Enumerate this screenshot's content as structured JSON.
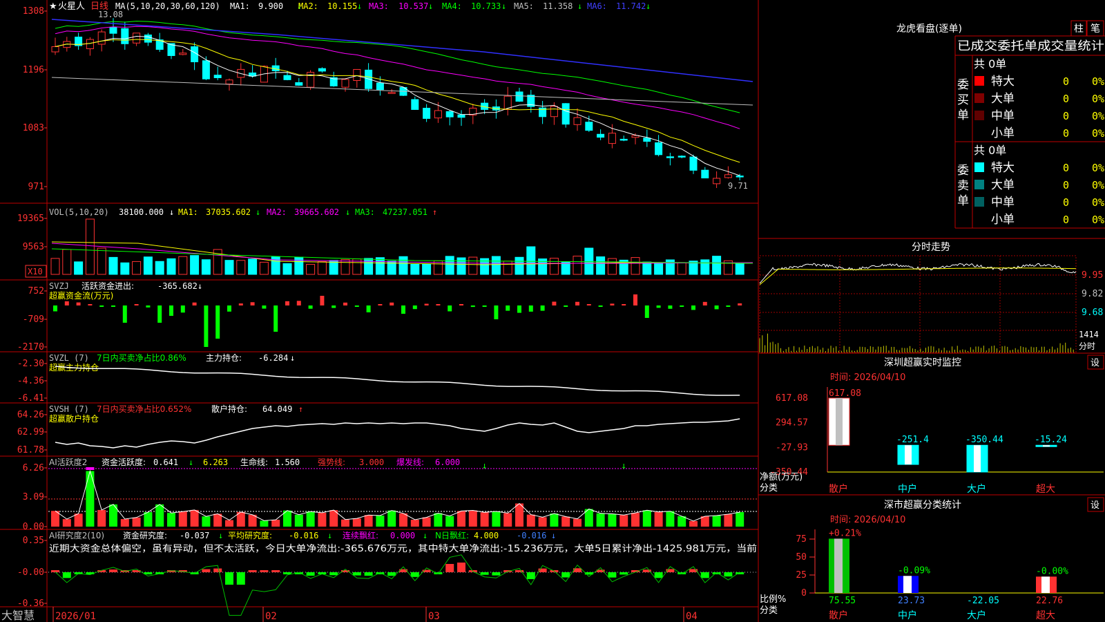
{
  "stock": {
    "name": "火星人",
    "period": "日线",
    "star": "★"
  },
  "price_panel": {
    "ma_label": "MA(5,10,20,30,60,120)",
    "mas": [
      {
        "name": "MA1:",
        "value": "9.900",
        "arrow": "↓",
        "color": "#ffffff"
      },
      {
        "name": "MA2:",
        "value": "10.155",
        "arrow": "↓",
        "color": "#ffff00"
      },
      {
        "name": "MA3:",
        "value": "10.537",
        "arrow": "↓",
        "color": "#ff00ff"
      },
      {
        "name": "MA4:",
        "value": "10.733",
        "arrow": "↓",
        "color": "#00ff00"
      },
      {
        "name": "MA5:",
        "value": "11.358",
        "arrow": "↓",
        "color": "#c0c0c0"
      },
      {
        "name": "MA6:",
        "value": "11.742",
        "arrow": "↓",
        "color": "#4040ff"
      }
    ],
    "y_ticks": [
      "1308",
      "1196",
      "1083",
      "971"
    ],
    "high_label": "13.08",
    "low_label": "9.71"
  },
  "vol_panel": {
    "label": "VOL(5,10,20)",
    "value": "38100.000",
    "arrow": "↓",
    "mas": [
      {
        "name": "MA1:",
        "value": "37035.602",
        "arrow": "↓",
        "color": "#ffff00"
      },
      {
        "name": "MA2:",
        "value": "39665.602",
        "arrow": "↓",
        "color": "#ff00ff"
      },
      {
        "name": "MA3:",
        "value": "47237.051",
        "arrow": "↑",
        "color": "#00ff00"
      }
    ],
    "y_ticks": [
      "19365",
      "9563"
    ],
    "unit": "X10"
  },
  "svzj_panel": {
    "label": "SVZJ",
    "title": "活跃资金进出:",
    "value": "-365.682",
    "arrow": "↓",
    "sub": "超赢资金流(万元)",
    "y_ticks": [
      "752",
      "-709",
      "-2170"
    ]
  },
  "svzl_panel": {
    "label": "SVZL (7)",
    "text1": "7日内买卖净占比0.86%",
    "text2": "主力持仓:",
    "value": "-6.284",
    "arrow": "↓",
    "sub": "超赢主力持仓",
    "y_ticks": [
      "-2.30",
      "-4.36",
      "-6.41"
    ]
  },
  "svsh_panel": {
    "label": "SVSH (7)",
    "text1": "7日内买卖净占比0.652%",
    "text2": "散户持仓:",
    "value": "64.049",
    "arrow": "↑",
    "sub": "超赢散户持仓",
    "y_ticks": [
      "64.26",
      "62.99",
      "61.78"
    ]
  },
  "ai_active_panel": {
    "label": "AI活跃度2",
    "text1": "资金活跃度:",
    "v1": "0.641",
    "a1": "↓",
    "v2": "6.263",
    "text2": "生命线:",
    "v3": "1.560",
    "text3": "强势线:",
    "v4": "3.000",
    "text4": "爆发线:",
    "v5": "6.000",
    "y_ticks": [
      "6.26",
      "3.09",
      "0.00"
    ]
  },
  "ai_research_panel": {
    "label": "AI研究度2(10)",
    "text1": "资金研究度:",
    "v1": "-0.037",
    "a1": "↓",
    "text2": "平均研究度:",
    "v2": "-0.016",
    "a2": "↓",
    "text3": "连续飘红:",
    "v3": "0.000",
    "a3": "↓",
    "text4": "N日飘红:",
    "v4": "4.000",
    "v5": "-0.016",
    "a5": "↓",
    "comment": "近期大资金总体偏空，虽有异动，但不太活跃，今日大单净流出:-365.676万元，其中特大单净流出:-15.236万元，大单5日累计净出-1425.981万元，当前",
    "y_ticks": [
      "0.35",
      "-0.00",
      "-0.36"
    ]
  },
  "x_axis": {
    "labels": [
      "2026/01",
      "02",
      "03",
      "04"
    ],
    "brand": "大智慧"
  },
  "right_top": {
    "title": "龙虎看盘(逐单)",
    "btn1": "柱",
    "btn2": "笔",
    "header": "已成交委托单成交量统计",
    "buy_side": "委买单",
    "sell_side": "委卖单",
    "buy_total": "共 0单",
    "sell_total": "共 0单",
    "buy_rows": [
      {
        "label": "特大",
        "count": "0",
        "pct": "0%",
        "color": "#ff0000"
      },
      {
        "label": "大单",
        "count": "0",
        "pct": "0%",
        "color": "#800000"
      },
      {
        "label": "中单",
        "count": "0",
        "pct": "0%",
        "color": "#600000"
      },
      {
        "label": "小单",
        "count": "0",
        "pct": "0%",
        "color": ""
      }
    ],
    "sell_rows": [
      {
        "label": "特大",
        "count": "0",
        "pct": "0%",
        "color": "#00ffff"
      },
      {
        "label": "大单",
        "count": "0",
        "pct": "0%",
        "color": "#008080"
      },
      {
        "label": "中单",
        "count": "0",
        "pct": "0%",
        "color": "#006060"
      },
      {
        "label": "小单",
        "count": "0",
        "pct": "0%",
        "color": ""
      }
    ]
  },
  "intraday": {
    "title": "分时走势",
    "y_ticks": [
      "9.95",
      "9.82",
      "9.68"
    ],
    "vol_top": "1414",
    "vol_label": "分时"
  },
  "sz_monitor": {
    "title": "深圳超赢实时监控",
    "btn": "设",
    "time": "时间: 2026/04/10",
    "y_ticks": [
      "617.08",
      "294.57",
      "-27.93",
      "-350.44"
    ],
    "axis_title": "净额(万元)",
    "axis_sub": "分类",
    "chart_data": {
      "type": "bar",
      "categories": [
        "散户",
        "中户",
        "大户",
        "超大"
      ],
      "values": [
        617.08,
        -251.4,
        -350.44,
        -15.24
      ],
      "value_labels": [
        "617.08",
        "-251.4",
        "-350.44",
        "-15.24"
      ],
      "ylim": [
        -350.44,
        617.08
      ],
      "xlabel": "分类",
      "ylabel": "净额(万元)"
    }
  },
  "sz_stats": {
    "title": "深市超赢分类统计",
    "btn": "设",
    "time": "时间: 2026/04/10",
    "y_ticks": [
      "75",
      "50",
      "25",
      "0"
    ],
    "axis_title": "比例%",
    "axis_sub": "分类",
    "chart_data": {
      "type": "bar",
      "categories": [
        "散户",
        "中户",
        "大户",
        "超大"
      ],
      "values": [
        75.55,
        23.73,
        -22.05,
        22.76
      ],
      "changes": [
        "+0.21%",
        "-0.09%",
        "",
        "-0.00%"
      ],
      "value_labels": [
        "75.55",
        "23.73",
        "-22.05",
        "22.76"
      ],
      "ylim": [
        0,
        75
      ],
      "xlabel": "分类",
      "ylabel": "比例%"
    }
  },
  "colors": {
    "up": "#ff3232",
    "down": "#00ffff",
    "grid": "#a00000",
    "frame": "#c00000",
    "label": "#c0c0c0"
  }
}
